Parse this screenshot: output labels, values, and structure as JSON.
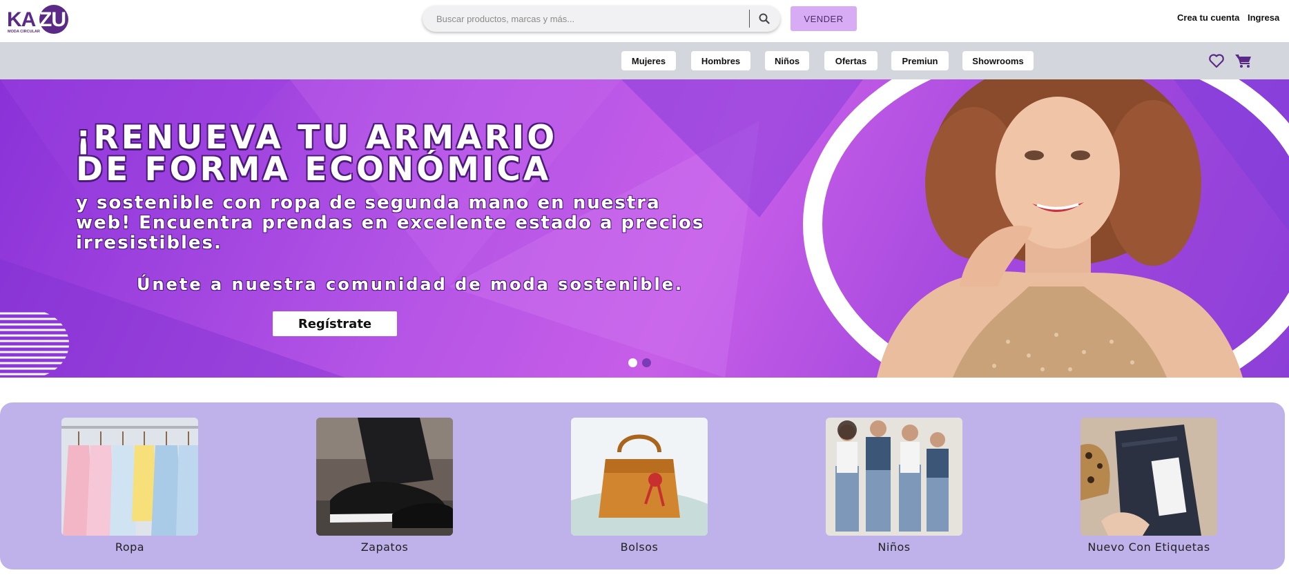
{
  "brand": {
    "name": "KAZU",
    "tagline": "MODA CIRCULAR",
    "color": "#5b2a86"
  },
  "search": {
    "placeholder": "Buscar productos, marcas y más...",
    "icon": "search-icon"
  },
  "header": {
    "sell_label": "VENDER",
    "create_account": "Crea tu cuenta",
    "login": "Ingresa"
  },
  "nav": {
    "items": [
      "Mujeres",
      "Hombres",
      "Niños",
      "Ofertas",
      "Premiun",
      "Showrooms"
    ],
    "icons": [
      "heart-icon",
      "cart-icon"
    ]
  },
  "hero": {
    "title_line1": "¡RENUEVA TU ARMARIO",
    "title_line2": "DE FORMA ECONÓMICA",
    "subtitle_line1": "y sostenible con ropa de segunda mano en nuestra",
    "subtitle_line2": "web! Encuentra prendas en excelente estado a precios",
    "subtitle_line3": "irresistibles.",
    "join_text": "Únete a nuestra comunidad de moda sostenible.",
    "cta_label": "Regístrate",
    "slides_total": 2,
    "active_slide": 1
  },
  "categories": [
    {
      "label": "Ropa"
    },
    {
      "label": "Zapatos"
    },
    {
      "label": "Bolsos"
    },
    {
      "label": "Niños"
    },
    {
      "label": "Nuevo Con Etiquetas"
    }
  ],
  "colors": {
    "accent": "#d7acf4",
    "nav_bg": "#d4d6de",
    "categories_bg": "#bfb2ea",
    "hero_purple": "#a448de"
  }
}
